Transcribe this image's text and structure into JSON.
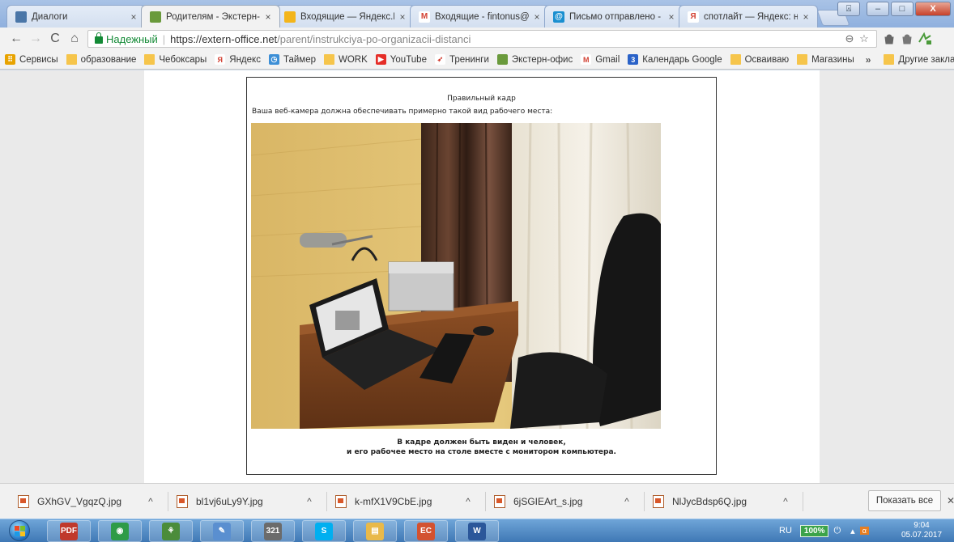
{
  "tabs": [
    {
      "title": "Диалоги",
      "icon": "vk-dialogs-icon",
      "color": "#4a76a8",
      "glyph": "",
      "active": false
    },
    {
      "title": "Родителям - Экстерн-оф",
      "icon": "extern-office-icon",
      "color": "#6a9a3c",
      "glyph": "",
      "active": true
    },
    {
      "title": "Входящие — Яндекс.По",
      "icon": "yandex-mail-icon",
      "color": "#f3b51b",
      "glyph": "",
      "active": false
    },
    {
      "title": "Входящие - fintonus@g",
      "icon": "gmail-icon",
      "color": "#ffffff",
      "glyph": "M",
      "active": false
    },
    {
      "title": "Письмо отправлено - П",
      "icon": "mail-sent-icon",
      "color": "#1a8fd0",
      "glyph": "@",
      "active": false
    },
    {
      "title": "спотлайт — Яндекс: наш",
      "icon": "yandex-icon",
      "color": "#ffffff",
      "glyph": "Я",
      "active": false
    }
  ],
  "window_buttons": {
    "user": "⍓",
    "minimize": "–",
    "maximize": "□",
    "close": "X"
  },
  "toolbar": {
    "back": "←",
    "forward": "→",
    "reload": "C",
    "home": "⌂",
    "secure_label": "Надежный",
    "url_host": "https://extern-office.net",
    "url_path": "/parent/instrukciya-po-organizacii-distanci",
    "zoom_icon": "⊖",
    "star_icon": "☆"
  },
  "bookmarks": [
    {
      "label": "Сервисы",
      "icon": "apps-icon",
      "color": "#e8a300",
      "glyph": "⠿"
    },
    {
      "label": "образование",
      "icon": "folder-icon",
      "folder": true
    },
    {
      "label": "Чебоксары",
      "icon": "folder-icon",
      "folder": true
    },
    {
      "label": "Яндекс",
      "icon": "yandex-icon",
      "color": "#ffffff",
      "glyph": "Я"
    },
    {
      "label": "Таймер",
      "icon": "timer-icon",
      "color": "#3d8fd6",
      "glyph": "◷"
    },
    {
      "label": "WORK",
      "icon": "folder-icon",
      "folder": true
    },
    {
      "label": "YouTube",
      "icon": "youtube-icon",
      "color": "#e52d27",
      "glyph": "▶"
    },
    {
      "label": "Тренинги",
      "icon": "trainings-icon",
      "color": "#ffffff",
      "glyph": "➶"
    },
    {
      "label": "Экстерн-офис",
      "icon": "extern-office-icon",
      "color": "#6a9a3c",
      "glyph": ""
    },
    {
      "label": "Gmail",
      "icon": "gmail-icon",
      "color": "#ffffff",
      "glyph": "M"
    },
    {
      "label": "Календарь Google",
      "icon": "google-calendar-icon",
      "color": "#2a62c8",
      "glyph": "3"
    },
    {
      "label": "Осваиваю",
      "icon": "folder-icon",
      "folder": true
    },
    {
      "label": "Магазины",
      "icon": "folder-icon",
      "folder": true
    }
  ],
  "bookmarks_more": "»",
  "other_bookmarks": "Другие закладки",
  "page": {
    "frame_title": "Правильный кадр",
    "intro": "Ваша веб-камера должна обеспечивать примерно такой вид рабочего места:",
    "caption_line1": "В кадре должен быть виден и человек,",
    "caption_line2": "и его рабочее место на столе вместе с монитором компьютера."
  },
  "downloads": [
    {
      "name": "GXhGV_VgqzQ.jpg"
    },
    {
      "name": "bl1vj6uLy9Y.jpg"
    },
    {
      "name": "k-mfX1V9CbE.jpg"
    },
    {
      "name": "6jSGIEArt_s.jpg"
    },
    {
      "name": "NlJycBdsp6Q.jpg"
    }
  ],
  "downloads_caret": "^",
  "show_all_label": "Показать все",
  "downloads_close": "✕",
  "taskbar": {
    "apps": [
      {
        "icon": "pdf-icon",
        "color": "#c0392b",
        "glyph": "PDF"
      },
      {
        "icon": "chrome-icon",
        "color": "#2e9b47",
        "glyph": "◉"
      },
      {
        "icon": "network-icon",
        "color": "#4b8c3a",
        "glyph": "⚘"
      },
      {
        "icon": "paint-icon",
        "color": "#5a8fd0",
        "glyph": "✎"
      },
      {
        "icon": "calendar-icon",
        "color": "#6b6b6b",
        "glyph": "321"
      },
      {
        "icon": "skype-icon",
        "color": "#00aff0",
        "glyph": "S"
      },
      {
        "icon": "explorer-icon",
        "color": "#e9b949",
        "glyph": "▤"
      },
      {
        "icon": "presentation-icon",
        "color": "#d35230",
        "glyph": "EC"
      },
      {
        "icon": "word-icon",
        "color": "#2b579a",
        "glyph": "W"
      }
    ],
    "lang": "RU",
    "battery": "100%",
    "time": "9:04",
    "date": "05.07.2017"
  }
}
